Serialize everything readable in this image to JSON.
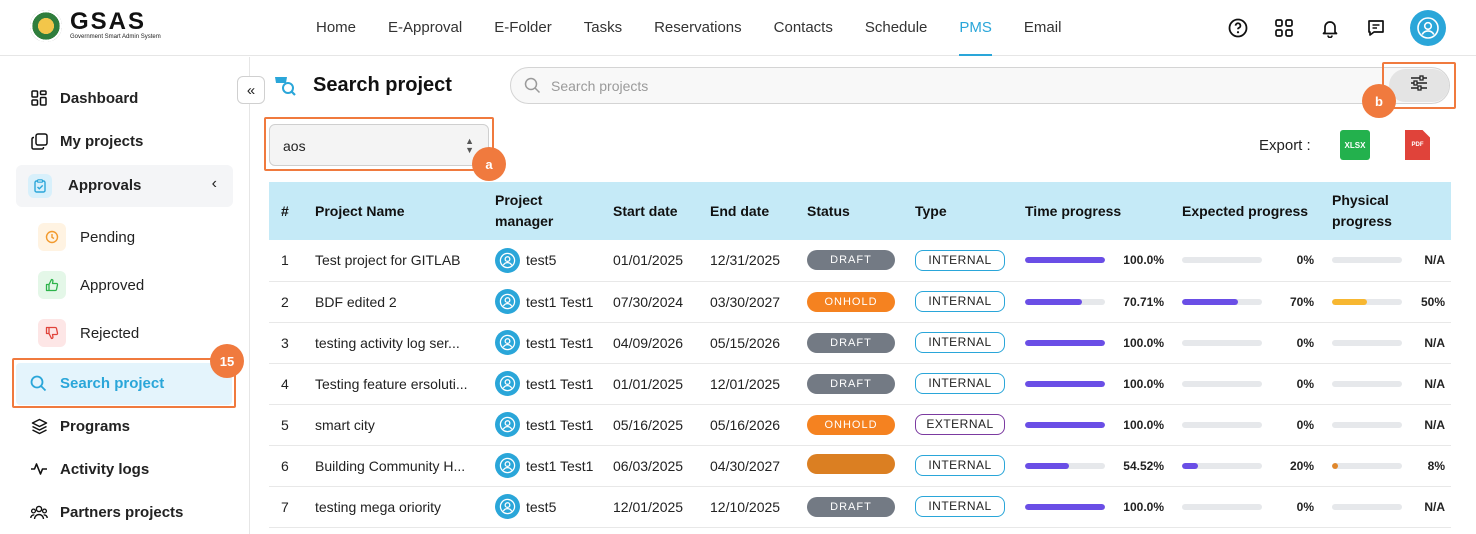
{
  "app": {
    "logo_main": "GSAS",
    "logo_sub": "Government Smart Admin System"
  },
  "nav": [
    "Home",
    "E-Approval",
    "E-Folder",
    "Tasks",
    "Reservations",
    "Contacts",
    "Schedule",
    "PMS",
    "Email"
  ],
  "nav_active": "PMS",
  "sidebar": {
    "dashboard": "Dashboard",
    "my_projects": "My projects",
    "approvals": "Approvals",
    "pending": "Pending",
    "approved": "Approved",
    "rejected": "Rejected",
    "search_project": "Search project",
    "programs": "Programs",
    "activity_logs": "Activity logs",
    "partners_projects": "Partners projects"
  },
  "annotations": {
    "side_badge": "15",
    "select_badge": "a",
    "filter_badge": "b"
  },
  "page": {
    "title": "Search project",
    "search_placeholder": "Search projects",
    "select_value": "aos",
    "export_label": "Export :",
    "xlsx": "XLSX",
    "pdf": "PDF"
  },
  "colors": {
    "accent": "#2aa6d9",
    "annotation": "#f07a3e",
    "draft": "#737a84",
    "onhold": "#f58220",
    "onhold_dark": "#db7f22",
    "internal_border": "#2aa6d9",
    "external_border": "#7b3aa0",
    "time_bar": "#6a4ee6",
    "physical_bar": "#f7b731",
    "physical_bar_alt": "#e0872b"
  },
  "table": {
    "headers": [
      "#",
      "Project Name",
      "Project manager",
      "Start date",
      "End date",
      "Status",
      "Type",
      "Time progress",
      "Expected progress",
      "Physical progress"
    ],
    "rows": [
      {
        "n": "1",
        "name": "Test project for GITLAB",
        "pm": "test5",
        "start": "01/01/2025",
        "end": "12/31/2025",
        "status": "DRAFT",
        "type": "INTERNAL",
        "time": 100,
        "time_label": "100.0%",
        "expected": 0,
        "expected_label": "0%",
        "physical": 0,
        "physical_label": "N/A"
      },
      {
        "n": "2",
        "name": "BDF edited 2",
        "pm": "test1 Test1",
        "start": "07/30/2024",
        "end": "03/30/2027",
        "status": "ONHOLD",
        "type": "INTERNAL",
        "time": 70.71,
        "time_label": "70.71%",
        "expected": 70,
        "expected_label": "70%",
        "physical": 50,
        "physical_label": "50%"
      },
      {
        "n": "3",
        "name": "testing activity log ser...",
        "pm": "test1 Test1",
        "start": "04/09/2026",
        "end": "05/15/2026",
        "status": "DRAFT",
        "type": "INTERNAL",
        "time": 100,
        "time_label": "100.0%",
        "expected": 0,
        "expected_label": "0%",
        "physical": 0,
        "physical_label": "N/A"
      },
      {
        "n": "4",
        "name": "Testing feature ersoluti...",
        "pm": "test1 Test1",
        "start": "01/01/2025",
        "end": "12/01/2025",
        "status": "DRAFT",
        "type": "INTERNAL",
        "time": 100,
        "time_label": "100.0%",
        "expected": 0,
        "expected_label": "0%",
        "physical": 0,
        "physical_label": "N/A"
      },
      {
        "n": "5",
        "name": "smart city",
        "pm": "test1 Test1",
        "start": "05/16/2025",
        "end": "05/16/2026",
        "status": "ONHOLD",
        "type": "EXTERNAL",
        "time": 100,
        "time_label": "100.0%",
        "expected": 0,
        "expected_label": "0%",
        "physical": 0,
        "physical_label": "N/A"
      },
      {
        "n": "6",
        "name": "Building Community H...",
        "pm": "test1 Test1",
        "start": "06/03/2025",
        "end": "04/30/2027",
        "status": "",
        "type": "INTERNAL",
        "time": 54.52,
        "time_label": "54.52%",
        "expected": 20,
        "expected_label": "20%",
        "physical": 8,
        "physical_label": "8%"
      },
      {
        "n": "7",
        "name": "testing mega oriority",
        "pm": "test5",
        "start": "12/01/2025",
        "end": "12/10/2025",
        "status": "DRAFT",
        "type": "INTERNAL",
        "time": 100,
        "time_label": "100.0%",
        "expected": 0,
        "expected_label": "0%",
        "physical": 0,
        "physical_label": "N/A"
      }
    ]
  }
}
